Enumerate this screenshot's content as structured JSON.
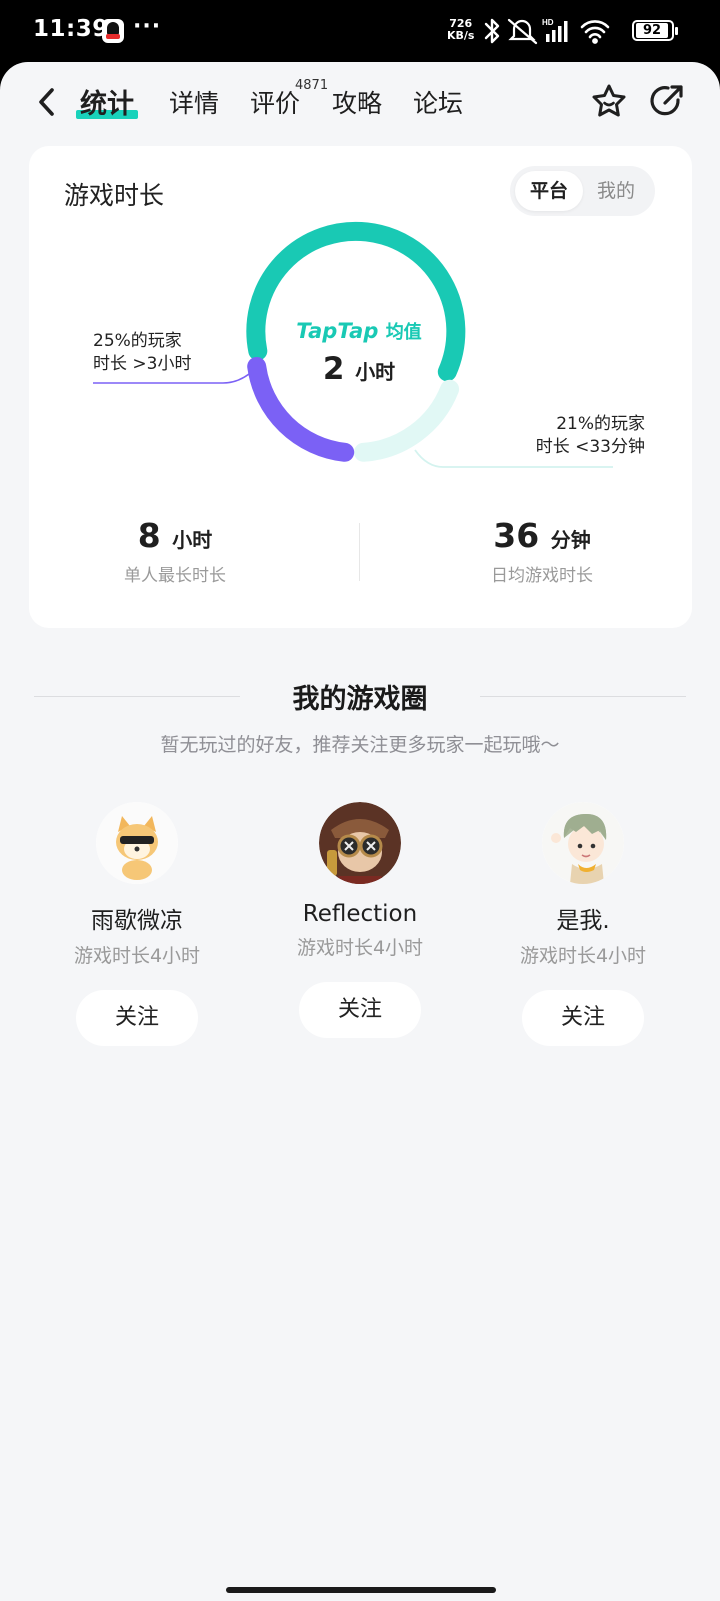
{
  "status_bar": {
    "time": "11:39",
    "dots": "···",
    "net_speed_value": "726",
    "net_speed_unit": "KB/s",
    "battery": "92",
    "icons": [
      "qq-icon",
      "bluetooth-icon",
      "mute-icon",
      "signal-icon",
      "wifi-icon",
      "battery-icon"
    ]
  },
  "nav": {
    "tabs": [
      {
        "label": "统计",
        "active": true
      },
      {
        "label": "详情"
      },
      {
        "label": "评价",
        "badge": "4871"
      },
      {
        "label": "攻略"
      },
      {
        "label": "论坛"
      }
    ]
  },
  "playtime_card": {
    "title": "游戏时长",
    "toggle": {
      "selected": "平台",
      "other": "我的"
    },
    "brand": "TapTap",
    "center_caption": "均值",
    "center_value": "2",
    "center_unit": "小时",
    "left_label_line1": "25%的玩家",
    "left_label_line2": "时长 >3小时",
    "right_label_line1": "21%的玩家",
    "right_label_line2": "时长 <33分钟",
    "stats": [
      {
        "value": "8",
        "unit": "小时",
        "label": "单人最长时长"
      },
      {
        "value": "36",
        "unit": "分钟",
        "label": "日均游戏时长"
      }
    ],
    "colors": {
      "teal": "#19c9b4",
      "purple": "#7b61f5",
      "light_teal": "#e1f8f5"
    }
  },
  "game_circle": {
    "title": "我的游戏圈",
    "subtitle": "暂无玩过的好友，推荐关注更多玩家一起玩哦～",
    "friends": [
      {
        "name": "雨歇微凉",
        "playtime": "游戏时长4小时",
        "follow": "关注"
      },
      {
        "name": "Reflection",
        "playtime": "游戏时长4小时",
        "follow": "关注"
      },
      {
        "name": "是我.",
        "playtime": "游戏时长4小时",
        "follow": "关注"
      }
    ]
  }
}
